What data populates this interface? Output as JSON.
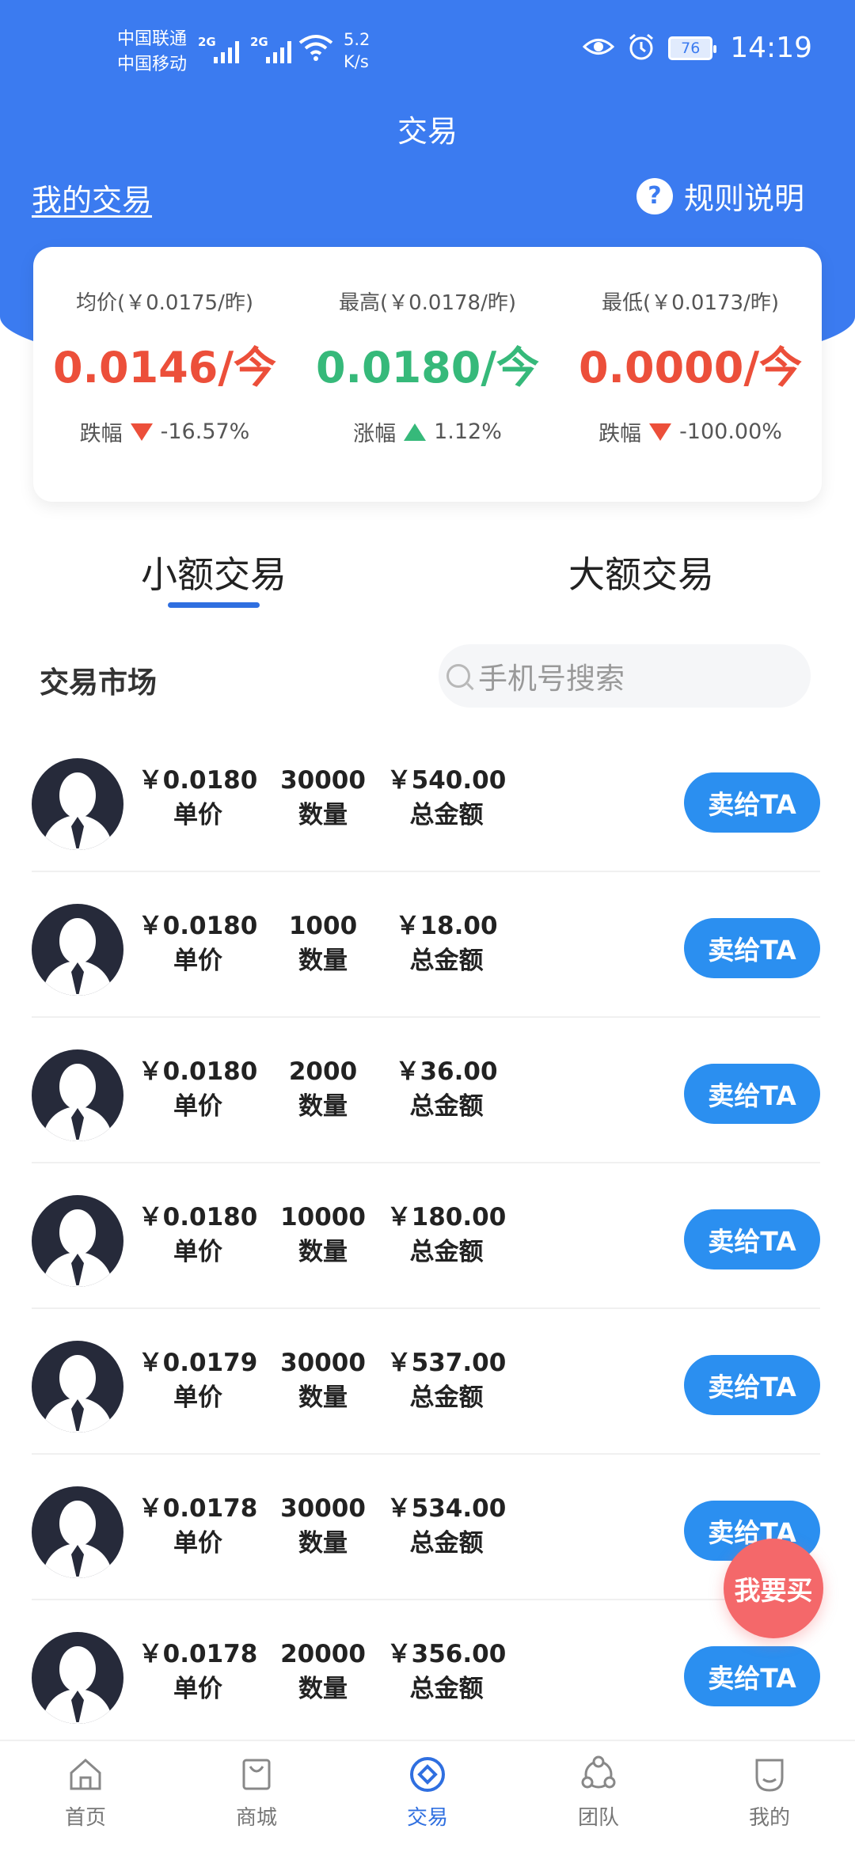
{
  "status_bar": {
    "carrier1": "中国联通",
    "carrier2": "中国移动",
    "sig1": "2G",
    "sig2": "2G",
    "net_speed_value": "5.2",
    "net_speed_unit": "K/s",
    "battery": "76",
    "time": "14:19"
  },
  "header": {
    "title": "交易",
    "my_trade": "我的交易",
    "rules": "规则说明",
    "rules_icon": "?"
  },
  "prices": [
    {
      "ref": "均价(￥0.0175/昨)",
      "value": "0.0146/今",
      "change_label": "跌幅",
      "change": "-16.57%",
      "direction": "down",
      "color": "#ec4f3a"
    },
    {
      "ref": "最高(￥0.0178/昨)",
      "value": "0.0180/今",
      "change_label": "涨幅",
      "change": "1.12%",
      "direction": "up",
      "color": "#36b97a"
    },
    {
      "ref": "最低(￥0.0173/昨)",
      "value": "0.0000/今",
      "change_label": "跌幅",
      "change": "-100.00%",
      "direction": "down",
      "color": "#ec4f3a"
    }
  ],
  "tabs": [
    {
      "label": "小额交易",
      "active": true
    },
    {
      "label": "大额交易",
      "active": false
    }
  ],
  "market": {
    "title": "交易市场",
    "search_placeholder": "手机号搜索"
  },
  "row_labels": {
    "price": "单价",
    "qty": "数量",
    "total": "总金额",
    "action": "卖给TA"
  },
  "orders": [
    {
      "price": "￥0.0180",
      "qty": "30000",
      "total": "￥540.00"
    },
    {
      "price": "￥0.0180",
      "qty": "1000",
      "total": "￥18.00"
    },
    {
      "price": "￥0.0180",
      "qty": "2000",
      "total": "￥36.00"
    },
    {
      "price": "￥0.0180",
      "qty": "10000",
      "total": "￥180.00"
    },
    {
      "price": "￥0.0179",
      "qty": "30000",
      "total": "￥537.00"
    },
    {
      "price": "￥0.0178",
      "qty": "30000",
      "total": "￥534.00"
    },
    {
      "price": "￥0.0178",
      "qty": "20000",
      "total": "￥356.00"
    }
  ],
  "float_button": "我要买",
  "nav": [
    {
      "label": "首页",
      "icon": "home-icon",
      "active": false
    },
    {
      "label": "商城",
      "icon": "shop-bag-icon",
      "active": false
    },
    {
      "label": "交易",
      "icon": "trade-icon",
      "active": true
    },
    {
      "label": "团队",
      "icon": "team-icon",
      "active": false
    },
    {
      "label": "我的",
      "icon": "profile-icon",
      "active": false
    }
  ],
  "colors": {
    "primary": "#3b7bf0",
    "button": "#2b8ff0",
    "down": "#ec4f3a",
    "up": "#36b97a",
    "float": "#f4686a"
  }
}
